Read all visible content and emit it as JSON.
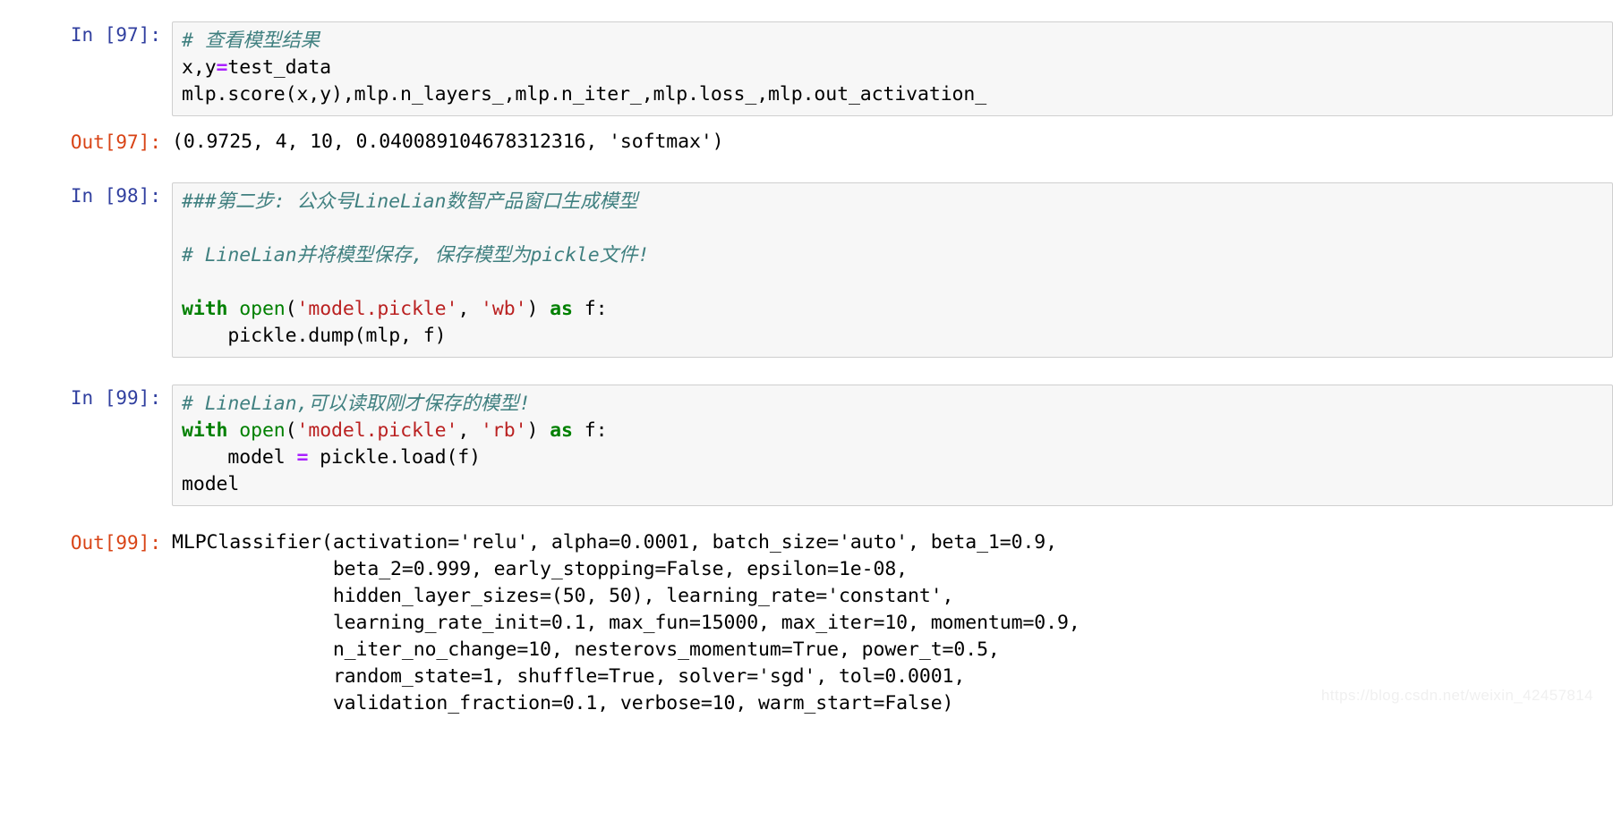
{
  "notebook": {
    "watermark": "https://blog.csdn.net/weixin_42457814",
    "cells": [
      {
        "id": "cell-97",
        "in_prompt": "In [97]:",
        "out_prompt": "Out[97]:",
        "source_lines": [
          "# 查看模型结果",
          "x,y=test_data",
          "mlp.score(x,y),mlp.n_layers_,mlp.n_iter_,mlp.loss_,mlp.out_activation_"
        ],
        "output_lines": [
          "(0.9725, 4, 10, 0.040089104678312316, 'softmax')"
        ]
      },
      {
        "id": "cell-98",
        "in_prompt": "In [98]:",
        "source_lines": [
          "###第二步: 公众号LineLian数智产品窗口生成模型",
          "",
          "# LineLian并将模型保存, 保存模型为pickle文件!",
          "",
          "with open('model.pickle', 'wb') as f:",
          "    pickle.dump(mlp, f)"
        ]
      },
      {
        "id": "cell-99",
        "in_prompt": "In [99]:",
        "out_prompt": "Out[99]:",
        "source_lines": [
          "# LineLian,可以读取刚才保存的模型!",
          "with open('model.pickle', 'rb') as f:",
          "    model = pickle.load(f)",
          "model"
        ],
        "output_lines": [
          "MLPClassifier(activation='relu', alpha=0.0001, batch_size='auto', beta_1=0.9,",
          "              beta_2=0.999, early_stopping=False, epsilon=1e-08,",
          "              hidden_layer_sizes=(50, 50), learning_rate='constant',",
          "              learning_rate_init=0.1, max_fun=15000, max_iter=10, momentum=0.9,",
          "              n_iter_no_change=10, nesterovs_momentum=True, power_t=0.5,",
          "              random_state=1, shuffle=True, solver='sgd', tol=0.0001,",
          "              validation_fraction=0.1, verbose=10, warm_start=False)"
        ]
      }
    ]
  },
  "colors": {
    "in_prompt": "#303F9F",
    "out_prompt": "#D84315",
    "comment": "#408080",
    "keyword": "#008000",
    "string": "#BA2121",
    "operator": "#AA22FF",
    "cell_background": "#f7f7f7",
    "cell_border": "#cfcfcf"
  }
}
